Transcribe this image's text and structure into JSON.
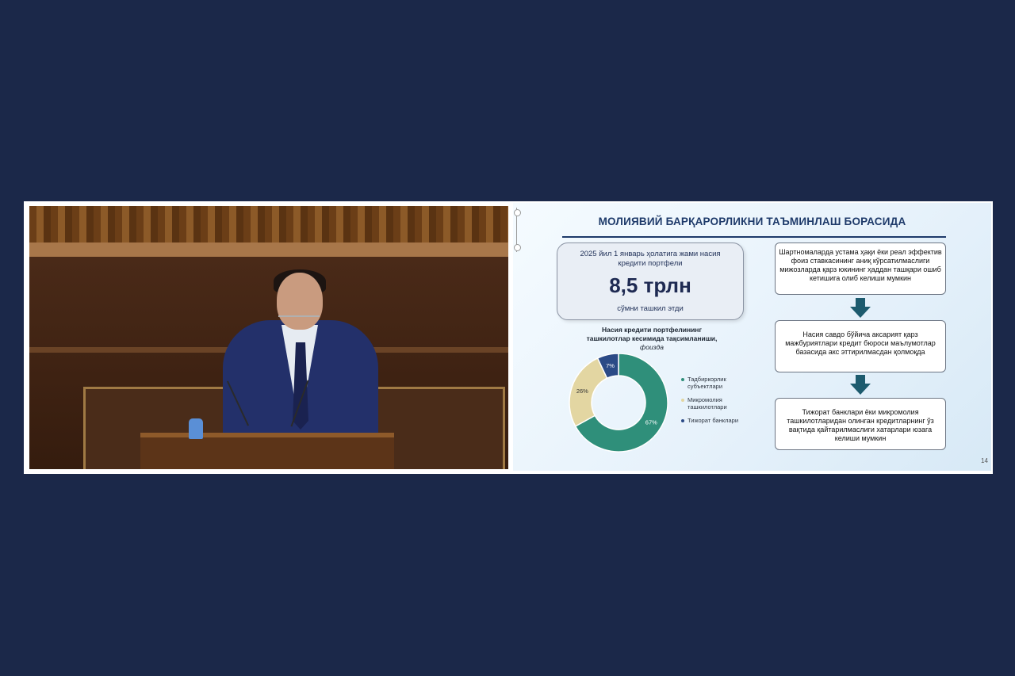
{
  "slide": {
    "title": "МОЛИЯВИЙ БАРҚАРОРЛИКНИ ТАЪМИНЛАШ БОРАСИДА",
    "kpi": {
      "top_text_line1": "2025 йил 1 январь ҳолатига жами насия",
      "top_text_line2": "кредити портфели",
      "value": "8,5 трлн",
      "bottom_text": "сўмни ташкил этди"
    },
    "chart_title_line1": "Насия кредити портфелининг",
    "chart_title_line2": "ташкилотлар кесимида тақсимланиши,",
    "chart_subtitle": "фоизда",
    "right_boxes": [
      {
        "text": "Шартномаларда устама ҳақи ёки реал эффектив фоиз ставкасининг аниқ кўрсатилмаслиги мижозларда қарз юкининг ҳаддан ташқари ошиб кетишига олиб келиши мумкин"
      },
      {
        "text": "Насия савдо бўйича аксарият қарз мажбуриятлари кредит бюроси маълумотлар базасида акс эттирилмасдан қолмоқда"
      },
      {
        "text": "Тижорат банклари ёки микромолия ташкилотларидан олинган кредитларнинг ўз вақтида қайтарилмаслиги хатарлари юзага келиши мумкин"
      }
    ],
    "page_number": "14",
    "colors": {
      "title": "#1e3a6a",
      "arrow": "#1d5b6e"
    }
  },
  "chart_data": {
    "type": "pie",
    "title": "Насия кредити портфелининг ташкилотлар кесимида тақсимланиши, фоизда",
    "categories": [
      "Тадбиркорлик субъектлари",
      "Микромолия ташкилотлари",
      "Тижорат банклари"
    ],
    "values": [
      67,
      26,
      7
    ],
    "labels": [
      "67%",
      "26%",
      "7%"
    ],
    "colors": [
      "#2f8f7a",
      "#e3d6a2",
      "#2b4a86"
    ],
    "legend": "right"
  },
  "icons": [
    "down-arrow-icon",
    "video-slider-icon"
  ]
}
